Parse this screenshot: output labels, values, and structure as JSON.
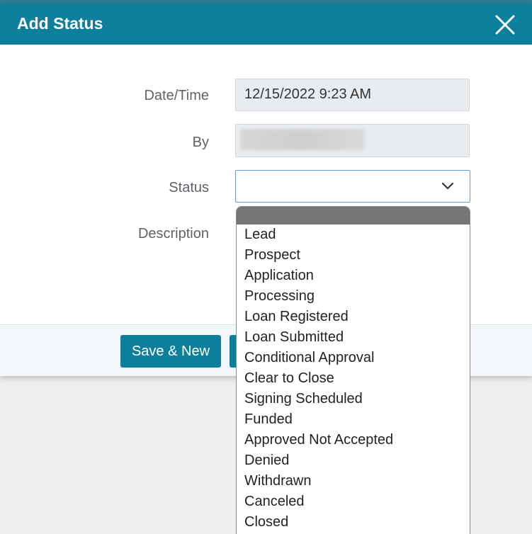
{
  "dialog": {
    "title": "Add Status"
  },
  "form": {
    "datetime_label": "Date/Time",
    "datetime_value": "12/15/2022 9:23 AM",
    "by_label": "By",
    "status_label": "Status",
    "description_label": "Description"
  },
  "footer": {
    "save_new_label": "Save & New"
  },
  "status_options": [
    "Lead",
    "Prospect",
    "Application",
    "Processing",
    "Loan Registered",
    "Loan Submitted",
    "Conditional Approval",
    "Clear to Close",
    "Signing Scheduled",
    "Funded",
    "Approved Not Accepted",
    "Denied",
    "Withdrawn",
    "Canceled",
    "Closed"
  ],
  "colors": {
    "header": "#0c7f9b",
    "button": "#0c7f9b",
    "highlight": "#767676"
  },
  "icons": {
    "close": "close-icon",
    "dropdown": "chevron-down-icon"
  }
}
